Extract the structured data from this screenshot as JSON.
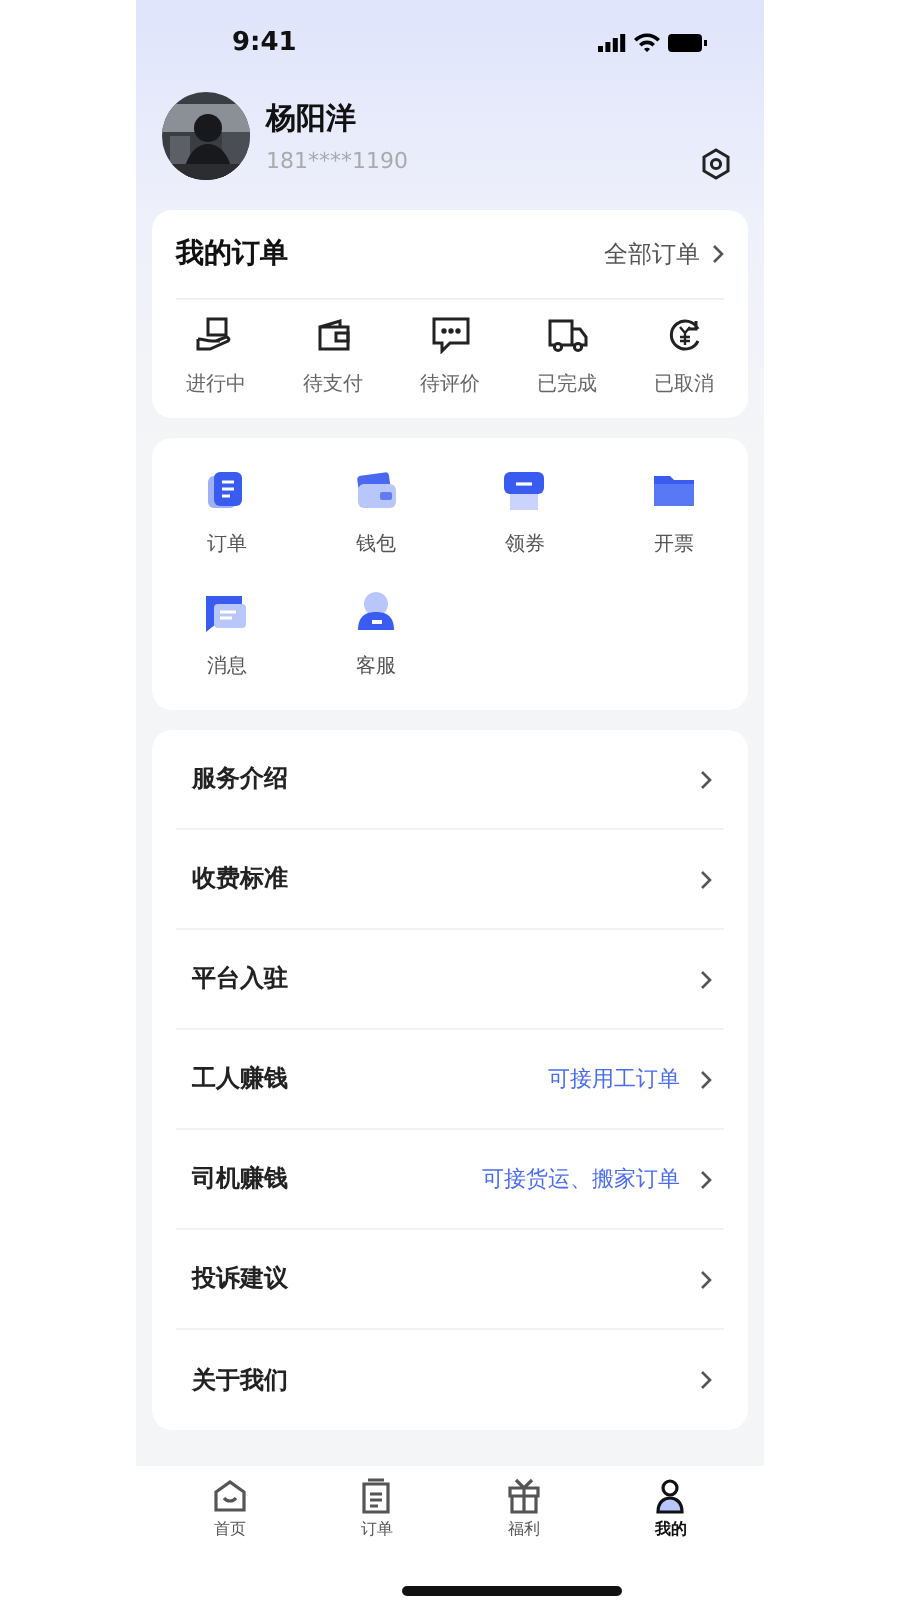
{
  "status_bar": {
    "time": "9:41"
  },
  "profile": {
    "name": "杨阳洋",
    "phone": "181****1190"
  },
  "orders": {
    "title": "我的订单",
    "link": "全部订单",
    "statuses": [
      {
        "label": "进行中",
        "kind": "in-progress"
      },
      {
        "label": "待支付",
        "kind": "unpaid"
      },
      {
        "label": "待评价",
        "kind": "review"
      },
      {
        "label": "已完成",
        "kind": "done"
      },
      {
        "label": "已取消",
        "kind": "cancelled"
      }
    ]
  },
  "services": [
    {
      "label": "订单",
      "kind": "orders"
    },
    {
      "label": "钱包",
      "kind": "wallet"
    },
    {
      "label": "领券",
      "kind": "coupon"
    },
    {
      "label": "开票",
      "kind": "invoice"
    },
    {
      "label": "消息",
      "kind": "message"
    },
    {
      "label": "客服",
      "kind": "support"
    }
  ],
  "menu": [
    {
      "label": "服务介绍"
    },
    {
      "label": "收费标准"
    },
    {
      "label": "平台入驻"
    },
    {
      "label": "工人赚钱",
      "hint": "可接用工订单"
    },
    {
      "label": "司机赚钱",
      "hint": "可接货运、搬家订单"
    },
    {
      "label": "投诉建议"
    },
    {
      "label": "关于我们"
    }
  ],
  "tab_bar": [
    {
      "label": "首页",
      "kind": "home",
      "selected": false
    },
    {
      "label": "订单",
      "kind": "orders",
      "selected": false
    },
    {
      "label": "福利",
      "kind": "gift",
      "selected": false
    },
    {
      "label": "我的",
      "kind": "me",
      "selected": true
    }
  ]
}
